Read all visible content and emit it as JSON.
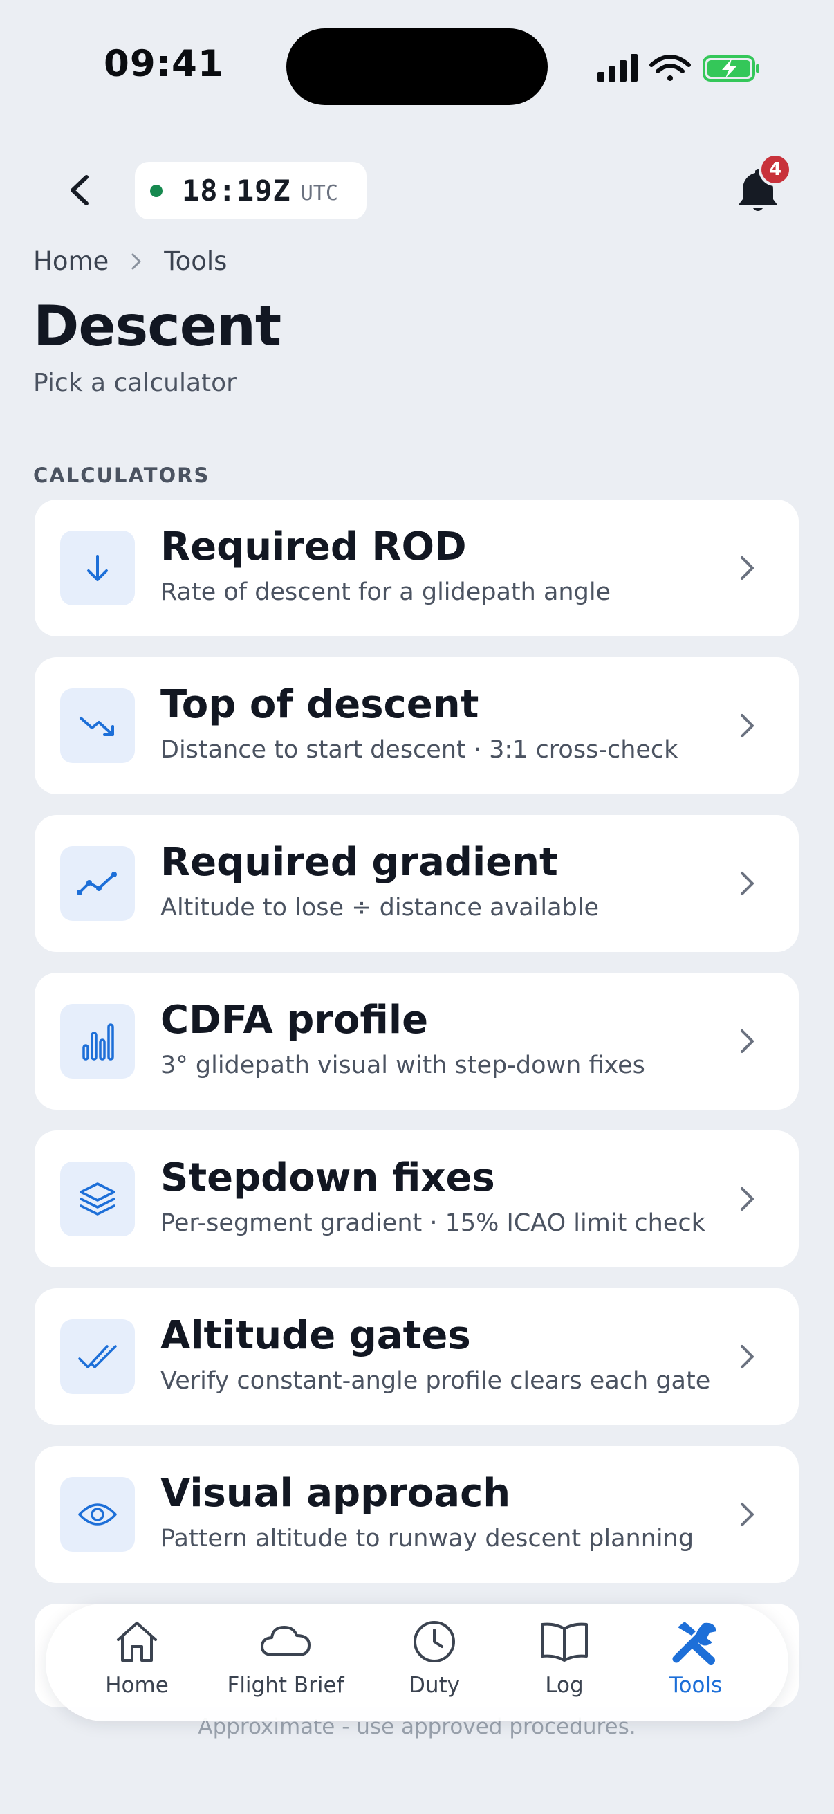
{
  "status_bar": {
    "time": "09:41"
  },
  "header": {
    "utc_time": "18:19Z",
    "utc_label": "UTC",
    "notification_count": "4"
  },
  "breadcrumb": {
    "home": "Home",
    "current": "Tools"
  },
  "page": {
    "title": "Descent",
    "subtitle": "Pick a calculator",
    "section_label": "CALCULATORS"
  },
  "calculators": [
    {
      "title": "Required ROD",
      "desc": "Rate of descent for a glidepath angle",
      "icon": "arrow-down-icon"
    },
    {
      "title": "Top of descent",
      "desc": "Distance to start descent · 3:1 cross-check",
      "icon": "trend-down-icon"
    },
    {
      "title": "Required gradient",
      "desc": "Altitude to lose ÷ distance available",
      "icon": "line-chart-icon"
    },
    {
      "title": "CDFA profile",
      "desc": "3° glidepath visual with step-down fixes",
      "icon": "bar-chart-icon"
    },
    {
      "title": "Stepdown fixes",
      "desc": "Per-segment gradient · 15% ICAO limit check",
      "icon": "layers-icon"
    },
    {
      "title": "Altitude gates",
      "desc": "Verify constant-angle profile clears each gate",
      "icon": "double-check-icon"
    },
    {
      "title": "Visual approach",
      "desc": "Pattern altitude to runway descent planning",
      "icon": "eye-icon"
    }
  ],
  "footer_note": "Approximate - use approved procedures.",
  "nav": {
    "home": "Home",
    "flight_brief": "Flight Brief",
    "duty": "Duty",
    "log": "Log",
    "tools": "Tools",
    "active": "tools"
  },
  "colors": {
    "accent": "#1d6fd8",
    "background": "#ebeef3",
    "card": "#ffffff",
    "icon_tile": "#e6eefb",
    "badge": "#c8323b",
    "utc_dot": "#16894f",
    "battery": "#34c759"
  }
}
